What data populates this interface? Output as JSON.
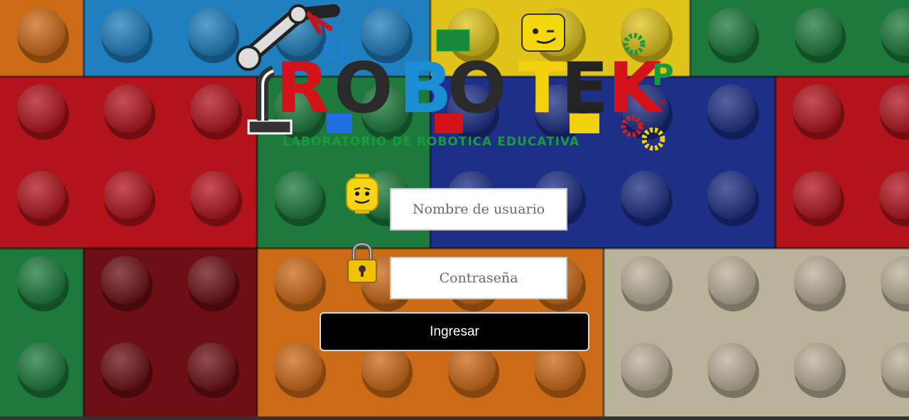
{
  "logo": {
    "letters": [
      "R",
      "O",
      "B",
      "O",
      "T",
      "E",
      "K",
      "P"
    ],
    "trademark": "®",
    "subtitle": "LABORATORIO DE ROBOTICA EDUCATIVA"
  },
  "login": {
    "username_placeholder": "Nombre de usuario",
    "password_placeholder": "Contraseña",
    "submit_label": "Ingresar"
  },
  "colors": {
    "brick_blue": "#1f7fbf",
    "brick_yellow": "#e0c419",
    "brick_green": "#1d7a3c",
    "brick_red": "#b3141c",
    "brick_navy": "#1d2f86",
    "brick_orange": "#cc6a16",
    "brick_gray": "#b9b39a",
    "brick_darkred": "#6d0f14",
    "button_bg": "#000000"
  },
  "icons": [
    "robot-arm-icon",
    "gear-icon",
    "lego-head-icon",
    "padlock-icon",
    "lego-block-icon"
  ]
}
